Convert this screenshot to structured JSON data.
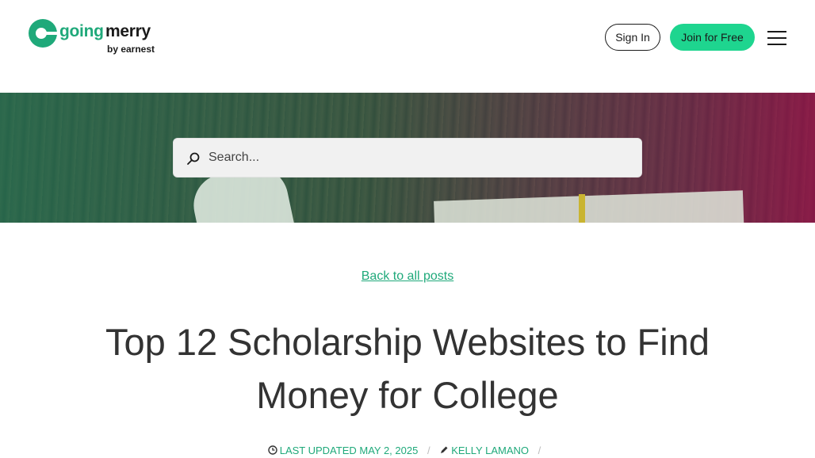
{
  "header": {
    "logo_word1": "going",
    "logo_word2": "merry",
    "logo_byline": "by earnest",
    "sign_in_label": "Sign In",
    "join_label": "Join for Free"
  },
  "hero": {
    "search_placeholder": "Search..."
  },
  "article": {
    "back_link": "Back to all posts",
    "title": "Top 12 Scholarship Websites to Find Money for College",
    "updated": "LAST UPDATED MAY 2, 2025",
    "author": "KELLY LAMANO",
    "separator": "/"
  },
  "colors": {
    "brand_green": "#1fa97a",
    "button_green": "#1ed58f"
  }
}
